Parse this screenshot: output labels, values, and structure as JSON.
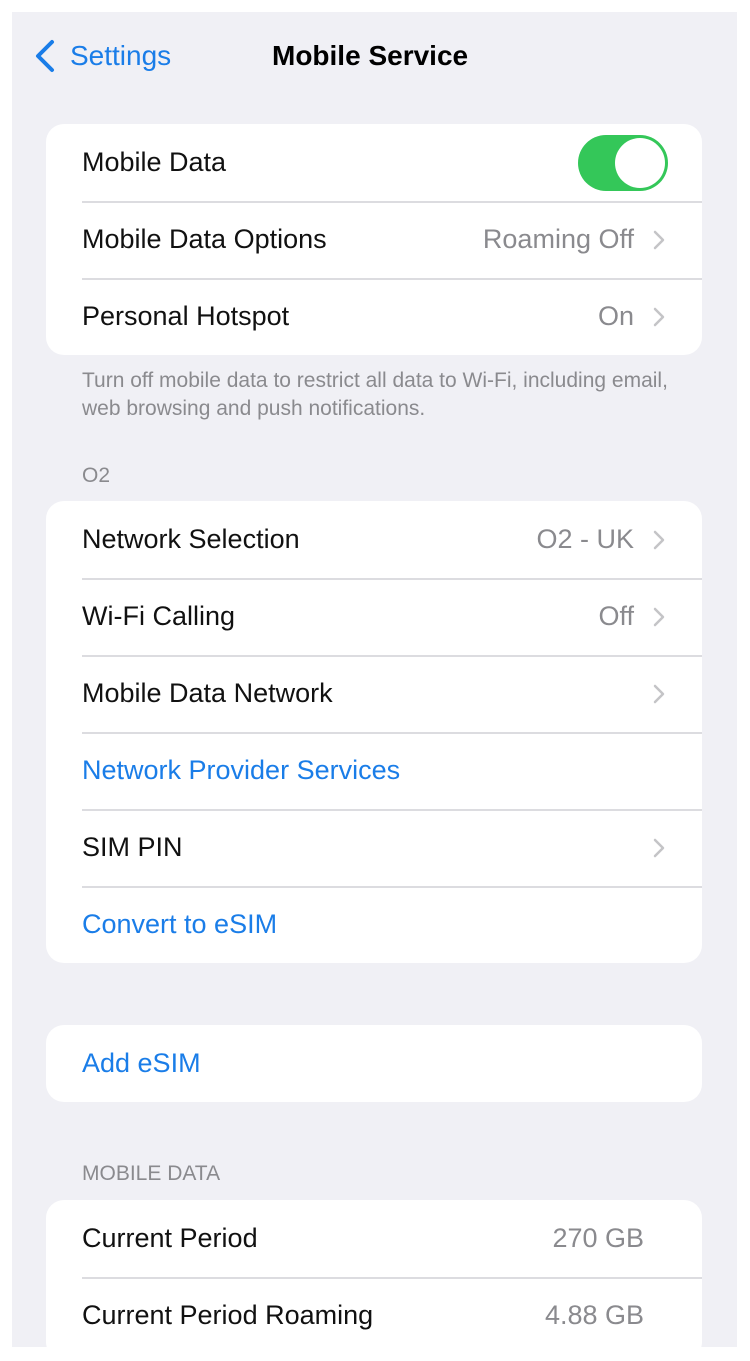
{
  "nav": {
    "back_label": "Settings",
    "title": "Mobile Service"
  },
  "colors": {
    "accent": "#1a7de8",
    "toggle_on": "#34c759",
    "background": "#f0f0f5",
    "secondary_text": "#8a8a8e"
  },
  "group1": {
    "rows": [
      {
        "label": "Mobile Data",
        "toggle": true
      },
      {
        "label": "Mobile Data Options",
        "value": "Roaming Off"
      },
      {
        "label": "Personal Hotspot",
        "value": "On"
      }
    ],
    "footer": "Turn off mobile data to restrict all data to Wi-Fi, including email, web browsing and push notifications."
  },
  "group2": {
    "header": "O2",
    "rows": [
      {
        "label": "Network Selection",
        "value": "O2 - UK"
      },
      {
        "label": "Wi-Fi Calling",
        "value": "Off"
      },
      {
        "label": "Mobile Data Network",
        "value": ""
      },
      {
        "label": "Network Provider Services"
      },
      {
        "label": "SIM PIN",
        "value": ""
      },
      {
        "label": "Convert to eSIM"
      }
    ]
  },
  "group3": {
    "rows": [
      {
        "label": "Add eSIM"
      }
    ]
  },
  "group4": {
    "header": "MOBILE DATA",
    "rows": [
      {
        "label": "Current Period",
        "value": "270 GB"
      },
      {
        "label": "Current Period Roaming",
        "value": "4.88 GB"
      }
    ]
  }
}
